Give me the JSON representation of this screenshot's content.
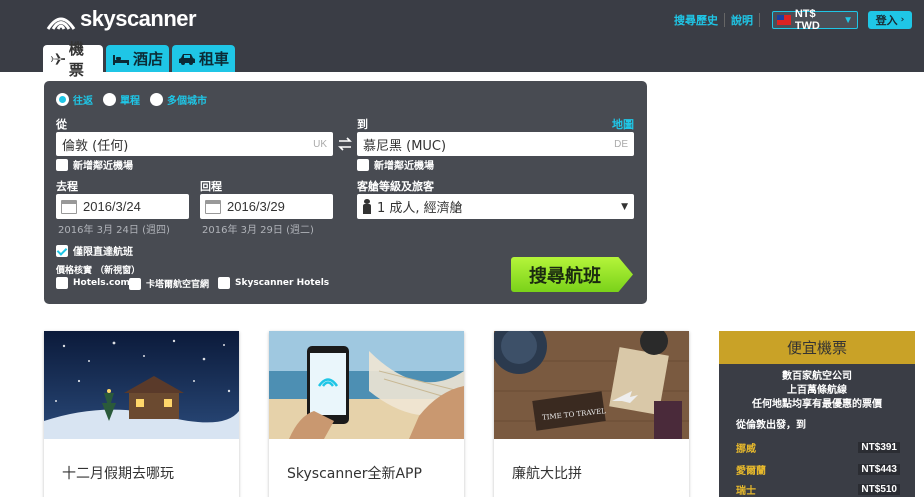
{
  "header": {
    "logo_text": "skyscanner",
    "links": {
      "history": "搜尋歷史",
      "help": "說明"
    },
    "currency": "NT$ TWD",
    "login": "登入"
  },
  "tabs": [
    {
      "label": "機票",
      "icon": "airplane-icon",
      "active": true
    },
    {
      "label": "酒店",
      "icon": "bed-icon",
      "active": false
    },
    {
      "label": "租車",
      "icon": "car-icon",
      "active": false
    }
  ],
  "search": {
    "trip_types": [
      "往返",
      "單程",
      "多個城市"
    ],
    "selected_trip": "往返",
    "from_label": "從",
    "to_label": "到",
    "map_link": "地圖",
    "from_value": "倫敦 (任何)",
    "from_code": "UK",
    "to_value": "慕尼黑 (MUC)",
    "to_code": "DE",
    "nearby_airports": "新增鄰近機場",
    "depart_label": "去程",
    "return_label": "回程",
    "depart_date": "2016/3/24",
    "return_date": "2016/3/29",
    "depart_sub": "2016年 3月 24日 (週四)",
    "return_sub": "2016年 3月 29日 (週二)",
    "cabin_label": "客艙等級及旅客",
    "cabin_value": "1 成人, 經濟艙",
    "direct_only": "僅限直達航班",
    "direct_checked": true,
    "compare_label": "價格核實 （新視窗）",
    "compare_options": [
      "Hotels.com",
      "卡塔爾航空官網",
      "Skyscanner Hotels"
    ],
    "search_button": "搜尋航班"
  },
  "cards": [
    {
      "title": "十二月假期去哪玩"
    },
    {
      "title": "Skyscanner全新APP"
    },
    {
      "title": "廉航大比拼"
    }
  ],
  "sidebar": {
    "title": "便宜機票",
    "desc_lines": [
      "數百家航空公司",
      "上百萬條航線",
      "任何地點均享有最優惠的票價"
    ],
    "from": "從倫敦出發，到",
    "deals": [
      {
        "dest": "挪威",
        "price": "NT$391"
      },
      {
        "dest": "愛爾蘭",
        "price": "NT$443"
      },
      {
        "dest": "瑞士",
        "price": "NT$510"
      }
    ]
  },
  "colors": {
    "header_bg": "#3a3d45",
    "accent": "#1fc6e6",
    "search_button": "#8fdc22",
    "sidebar_head": "#c9a227"
  }
}
